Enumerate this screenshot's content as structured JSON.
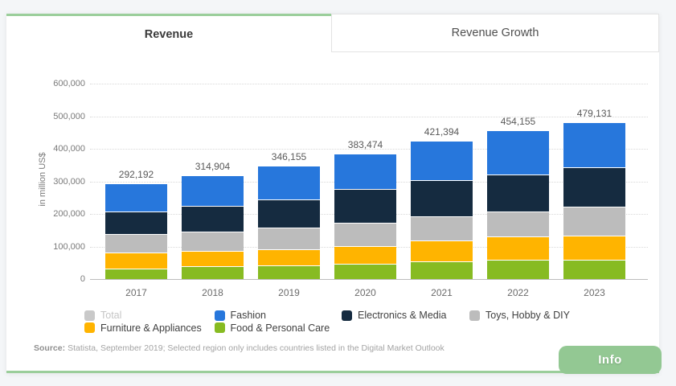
{
  "page": {
    "background": "#f4f6f8",
    "accent_green": "#9bce9b"
  },
  "tabs": [
    {
      "label": "Revenue",
      "active": true
    },
    {
      "label": "Revenue Growth",
      "active": false
    }
  ],
  "info_button": {
    "label": "Info"
  },
  "source_note": {
    "prefix": "Source:",
    "text": "Statista, September 2019; Selected region only includes countries listed in the Digital Market Outlook"
  },
  "chart_data": {
    "type": "bar",
    "stacked": true,
    "title": "",
    "xlabel": "",
    "ylabel": "in million US$",
    "ylim": [
      0,
      600000
    ],
    "ytick_step": 100000,
    "ytick_labels": [
      "600,000",
      "500,000",
      "400,000",
      "300,000",
      "200,000",
      "100,000",
      "0"
    ],
    "grid": "horizontal-dotted",
    "legend_position": "bottom",
    "categories": [
      "2017",
      "2018",
      "2019",
      "2020",
      "2021",
      "2022",
      "2023"
    ],
    "totals": [
      292192,
      314904,
      346155,
      383474,
      421394,
      454155,
      479131
    ],
    "total_labels": [
      "292,192",
      "314,904",
      "346,155",
      "383,474",
      "421,394",
      "454,155",
      "479,131"
    ],
    "series": [
      {
        "name": "Food & Personal Care",
        "color": "#87bb22",
        "values": [
          32200,
          39900,
          40800,
          47400,
          54000,
          58400,
          59100
        ]
      },
      {
        "name": "Furniture & Appliances",
        "color": "#ffb400",
        "values": [
          48400,
          46900,
          49800,
          54000,
          64100,
          72300,
          74000
        ]
      },
      {
        "name": "Toys, Hobby & DIY",
        "color": "#bcbcbc",
        "values": [
          58000,
          58100,
          66400,
          72300,
          74800,
          77300,
          88800
        ]
      },
      {
        "name": "Electronics & Media",
        "color": "#152b40",
        "values": [
          68300,
          79500,
          87200,
          102200,
          111100,
          113000,
          122200
        ]
      },
      {
        "name": "Fashion",
        "color": "#2777dc",
        "values": [
          85292,
          90504,
          101955,
          107574,
          117394,
          133155,
          135031
        ]
      }
    ],
    "legend": {
      "items": [
        {
          "label": "Total",
          "color": "#c9c9c9",
          "disabled": true
        },
        {
          "label": "Fashion",
          "color": "#2777dc",
          "disabled": false
        },
        {
          "label": "Electronics & Media",
          "color": "#152b40",
          "disabled": false
        },
        {
          "label": "Toys, Hobby & DIY",
          "color": "#bcbcbc",
          "disabled": false
        },
        {
          "label": "Furniture & Appliances",
          "color": "#ffb400",
          "disabled": false
        },
        {
          "label": "Food & Personal Care",
          "color": "#87bb22",
          "disabled": false
        }
      ]
    }
  }
}
